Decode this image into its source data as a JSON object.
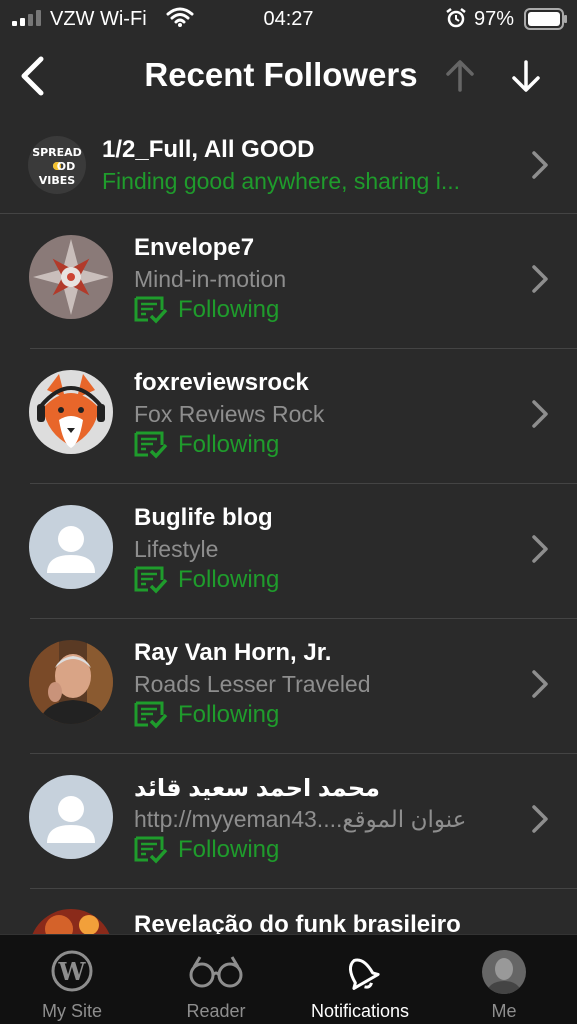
{
  "status": {
    "carrier": "VZW Wi-Fi",
    "time": "04:27",
    "battery": "97%"
  },
  "nav": {
    "title": "Recent Followers"
  },
  "followers": [
    {
      "name": "1/2_Full, All GOOD",
      "subtitle": "Finding good anywhere, sharing i...",
      "following": "",
      "avatar": "spread-good-vibes"
    },
    {
      "name": "Envelope7",
      "subtitle": "Mind-in-motion",
      "following": "Following",
      "avatar": "kaleidoscope"
    },
    {
      "name": "foxreviewsrock",
      "subtitle": "Fox Reviews Rock",
      "following": "Following",
      "avatar": "fox"
    },
    {
      "name": "Buglife blog",
      "subtitle": "Lifestyle",
      "following": "Following",
      "avatar": "default-user"
    },
    {
      "name": "Ray Van Horn, Jr.",
      "subtitle": "Roads Lesser Traveled",
      "following": "Following",
      "avatar": "photo-man"
    },
    {
      "name": "محمد احمد سعيد قائد",
      "subtitle": "http://myyeman43....عنوان الموقع",
      "following": "Following",
      "avatar": "default-user"
    },
    {
      "name": "Revelação do funk brasileiro",
      "subtitle": "",
      "following": "",
      "avatar": "photo-red"
    }
  ],
  "tabs": [
    {
      "label": "My Site",
      "icon": "wordpress-icon"
    },
    {
      "label": "Reader",
      "icon": "glasses-icon"
    },
    {
      "label": "Notifications",
      "icon": "bell-icon"
    },
    {
      "label": "Me",
      "icon": "avatar-icon"
    }
  ],
  "colors": {
    "accent": "#1f9c2c",
    "background": "#2a2a2a",
    "muted": "#8e8e8e"
  }
}
